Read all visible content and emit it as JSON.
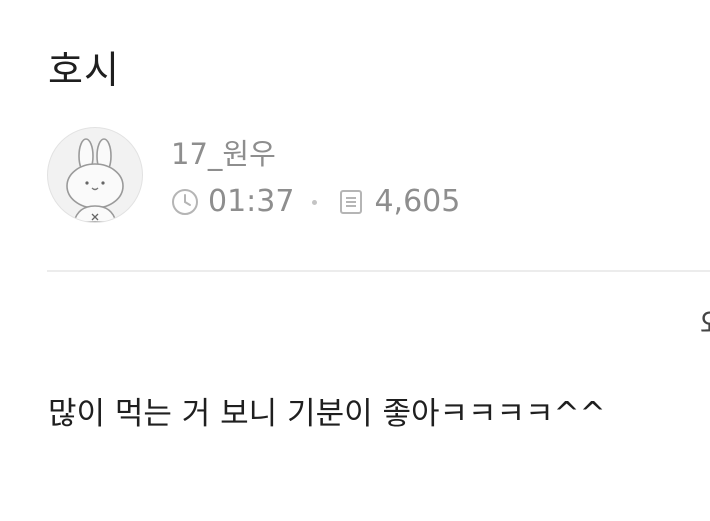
{
  "post": {
    "title": "호시",
    "author": {
      "name": "17_원우",
      "avatar_icon": "bunny-avatar-icon"
    },
    "stats": {
      "time": "01:37",
      "time_icon": "clock-icon",
      "count": "4,605",
      "count_icon": "document-icon"
    },
    "right_edge_text": "와",
    "body": "많이 먹는 거 보니 기분이 좋아ㅋㅋㅋㅋ^^"
  },
  "colors": {
    "text": "#1f1f1f",
    "meta_text": "#8e8e8e",
    "divider": "#ececec",
    "avatar_bg": "#f2f2f2"
  }
}
